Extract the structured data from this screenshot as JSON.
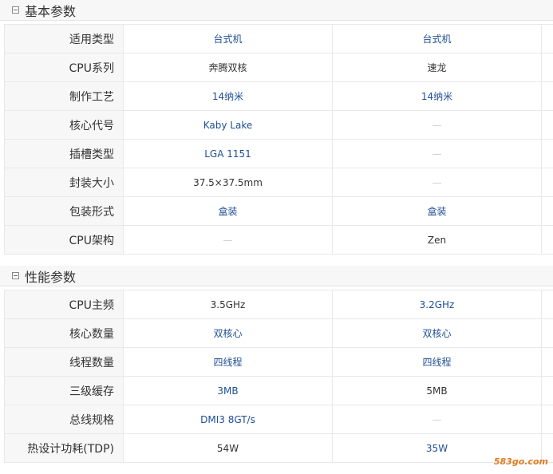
{
  "sections": [
    {
      "title": "基本参数",
      "rows": [
        {
          "label": "适用类型",
          "v1": "台式机",
          "v1_style": "link",
          "v2": "台式机",
          "v2_style": "link"
        },
        {
          "label": "CPU系列",
          "v1": "奔腾双核",
          "v1_style": "plain",
          "v2": "速龙",
          "v2_style": "plain"
        },
        {
          "label": "制作工艺",
          "v1": "14纳米",
          "v1_style": "link",
          "v2": "14纳米",
          "v2_style": "link"
        },
        {
          "label": "核心代号",
          "v1": "Kaby Lake",
          "v1_style": "link",
          "v2": "—",
          "v2_style": "dash"
        },
        {
          "label": "插槽类型",
          "v1": "LGA 1151",
          "v1_style": "link",
          "v2": "—",
          "v2_style": "dash"
        },
        {
          "label": "封装大小",
          "v1": "37.5×37.5mm",
          "v1_style": "plain",
          "v2": "—",
          "v2_style": "dash"
        },
        {
          "label": "包装形式",
          "v1": "盒装",
          "v1_style": "link",
          "v2": "盒装",
          "v2_style": "link"
        },
        {
          "label": "CPU架构",
          "v1": "—",
          "v1_style": "dash",
          "v2": "Zen",
          "v2_style": "plain"
        }
      ]
    },
    {
      "title": "性能参数",
      "rows": [
        {
          "label": "CPU主频",
          "v1": "3.5GHz",
          "v1_style": "plain",
          "v2": "3.2GHz",
          "v2_style": "link"
        },
        {
          "label": "核心数量",
          "v1": "双核心",
          "v1_style": "link",
          "v2": "双核心",
          "v2_style": "link"
        },
        {
          "label": "线程数量",
          "v1": "四线程",
          "v1_style": "link",
          "v2": "四线程",
          "v2_style": "link"
        },
        {
          "label": "三级缓存",
          "v1": "3MB",
          "v1_style": "link",
          "v2": "5MB",
          "v2_style": "plain"
        },
        {
          "label": "总线规格",
          "v1": "DMI3 8GT/s",
          "v1_style": "link",
          "v2": "—",
          "v2_style": "dash"
        },
        {
          "label": "热设计功耗(TDP)",
          "v1": "54W",
          "v1_style": "plain",
          "v2": "35W",
          "v2_style": "link"
        }
      ]
    }
  ],
  "watermark": "583go.com",
  "colors": {
    "link": "#1f4e96",
    "text": "#333333",
    "dash": "#cfcfcf",
    "label_bg": "#f7f7f7",
    "border": "#e8e8e8"
  }
}
